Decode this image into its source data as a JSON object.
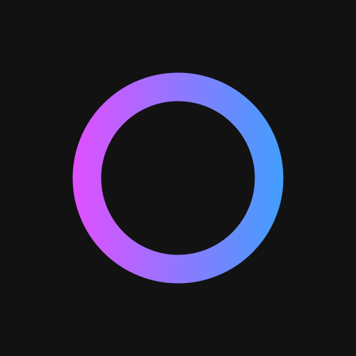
{
  "canvas": {
    "background_color": "#121213"
  },
  "ring": {
    "icon": "ring-icon",
    "gradient_start_color": "#e14fff",
    "gradient_end_color": "#419ffd"
  }
}
